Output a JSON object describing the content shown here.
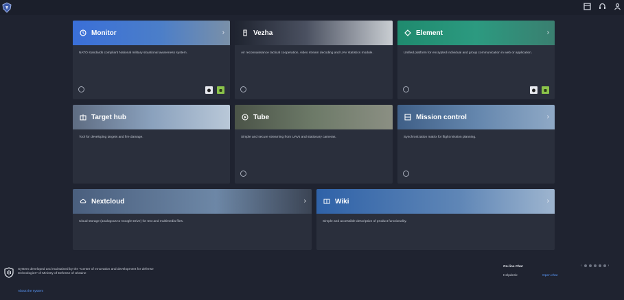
{
  "header": {
    "icons": [
      "logo-icon",
      "cards-icon",
      "headset-icon",
      "user-icon"
    ]
  },
  "cards": [
    {
      "id": "monitor",
      "title": "Monitor",
      "icon": "clock-icon",
      "desc": "NATO standards compliant National military situational awareness system.",
      "accent": "#3a6fd8"
    },
    {
      "id": "vezha",
      "title": "Vezha",
      "icon": "tower-icon",
      "desc": "Air reconnaissance tactical cooperation, video stream decoding and UAV statistics module.",
      "accent": "#5a6068"
    },
    {
      "id": "element",
      "title": "Element",
      "icon": "diamond-icon",
      "desc": "Unified platform for encrypted individual and group communication in web or application.",
      "accent": "#1f8a6e"
    },
    {
      "id": "targethub",
      "title": "Target hub",
      "icon": "target-hub-icon",
      "desc": "Tool for developing targets and fire damage.",
      "accent": "#6f8aa8"
    },
    {
      "id": "tube",
      "title": "Tube",
      "icon": "play-icon",
      "desc": "Simple and secure streaming from UAVs and stationary cameras.",
      "accent": "#5d6a5b"
    },
    {
      "id": "missioncontrol",
      "title": "Mission control",
      "icon": "mission-icon",
      "desc": "Synchronization matrix for flight mission planning.",
      "accent": "#4f6f94"
    },
    {
      "id": "nextcloud",
      "title": "Nextcloud",
      "icon": "cloud-icon",
      "desc": "Cloud storage (analogous to Google Drive) for text and multimedia files.",
      "accent": "#4a5f7e"
    },
    {
      "id": "wiki",
      "title": "Wiki",
      "icon": "book-icon",
      "desc": "Simple and accessible description of product functionality.",
      "accent": "#3c6fb0"
    }
  ],
  "footer": {
    "text": "System developed and maintained by the \"Center of Innovation and development for defense technologies\" of Ministry of Defense of Ukraine",
    "about_link": "About the system",
    "online_chat": "On-line Chat",
    "helpdesk": "Helpdesk:",
    "open_chat": "Open chat"
  }
}
